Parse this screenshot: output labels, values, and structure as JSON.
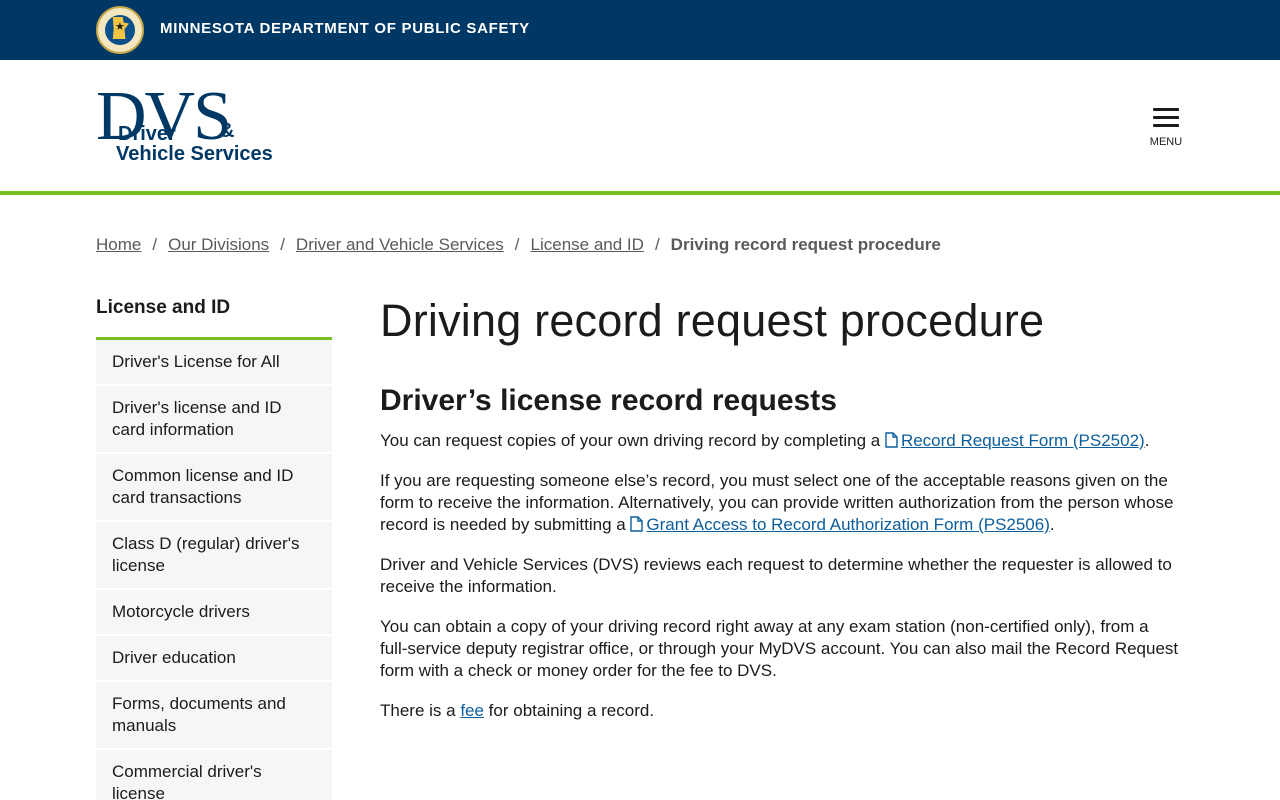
{
  "agency": {
    "name": "MINNESOTA DEPARTMENT OF PUBLIC SAFETY",
    "seal_icon": "state-seal-icon"
  },
  "header": {
    "logo_big": "DVS",
    "logo_line1": "Driver",
    "logo_amp": "&",
    "logo_line2": "Vehicle Services",
    "menu_label": "MENU"
  },
  "breadcrumb": {
    "items": [
      "Home",
      "Our Divisions",
      "Driver and Vehicle Services",
      "License and ID"
    ],
    "separator": "/",
    "current": "Driving record request procedure"
  },
  "sidebar": {
    "title": "License and ID",
    "items": [
      "Driver's License for All",
      "Driver's license and ID card information",
      "Common license and ID card transactions",
      "Class D (regular) driver's license",
      "Motorcycle drivers",
      "Driver education",
      "Forms, documents and manuals",
      "Commercial driver's license"
    ]
  },
  "main": {
    "title": "Driving record request procedure",
    "section_title": "Driver’s license record requests",
    "p1": {
      "before": "You can request copies of your own driving record by completing a ",
      "link": "Record Request Form (PS2502)",
      "after": "."
    },
    "p2": {
      "before": "If you are requesting someone else’s record,  you must select one of the acceptable reasons given on the form to receive the information.  Alternatively, you can provide written authorization from the person whose record is needed by submitting a ",
      "link": "Grant Access to Record Authorization Form (PS2506)",
      "after": "."
    },
    "p3": "Driver and Vehicle Services (DVS) reviews each request to determine whether the requester is allowed to receive the information.",
    "p4": "You can obtain a copy of your driving record right away at any exam station (non-certified only), from a full-service deputy registrar office, or through your MyDVS account.  You can also mail the Record Request form with a check or money order for the fee to DVS.",
    "p5": {
      "before": "There is a ",
      "link": "fee",
      "after": " for obtaining a record."
    }
  },
  "colors": {
    "topbar": "#003865",
    "accent_green": "#78be21",
    "link": "#0b5e9b",
    "sidebar_bg": "#f5f6f7"
  }
}
